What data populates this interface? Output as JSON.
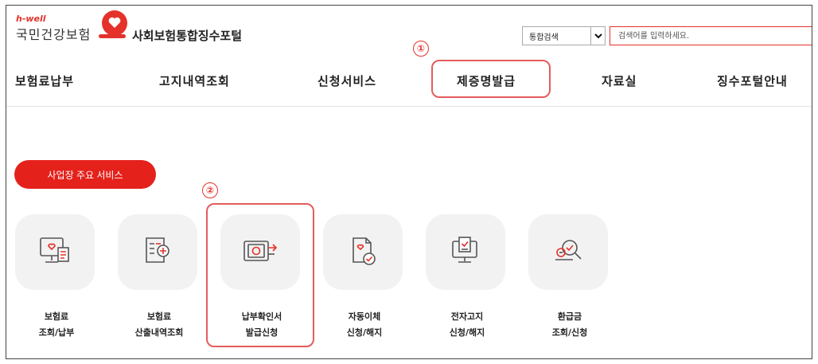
{
  "header": {
    "brand_small": "h-well",
    "brand_name": "국민건강보험",
    "portal_title": "사회보험통합징수포털",
    "search": {
      "scope_selected": "통합검색",
      "placeholder": "검색어를 입력하세요."
    }
  },
  "nav": {
    "items": [
      {
        "label": "보험료납부"
      },
      {
        "label": "고지내역조회"
      },
      {
        "label": "신청서비스"
      },
      {
        "label": "제증명발급"
      },
      {
        "label": "자료실"
      },
      {
        "label": "징수포털안내"
      }
    ]
  },
  "annotations": {
    "step1": "①",
    "step2": "②"
  },
  "main": {
    "section_button": "사업장 주요 서비스",
    "services": [
      {
        "line1": "보험료",
        "line2": "조회/납부",
        "icon": "monitor-receipt-icon"
      },
      {
        "line1": "보험료",
        "line2": "산출내역조회",
        "icon": "calculation-document-icon"
      },
      {
        "line1": "납부확인서",
        "line2": "발급신청",
        "icon": "certificate-issue-icon"
      },
      {
        "line1": "자동이체",
        "line2": "신청/해지",
        "icon": "auto-transfer-document-icon"
      },
      {
        "line1": "전자고지",
        "line2": "신청/해지",
        "icon": "electronic-notice-icon"
      },
      {
        "line1": "환급금",
        "line2": "조회/신청",
        "icon": "refund-search-icon"
      }
    ]
  },
  "colors": {
    "accent": "#e4211b",
    "highlight": "#e45c5c",
    "tile_bg": "#f2f2f2"
  }
}
